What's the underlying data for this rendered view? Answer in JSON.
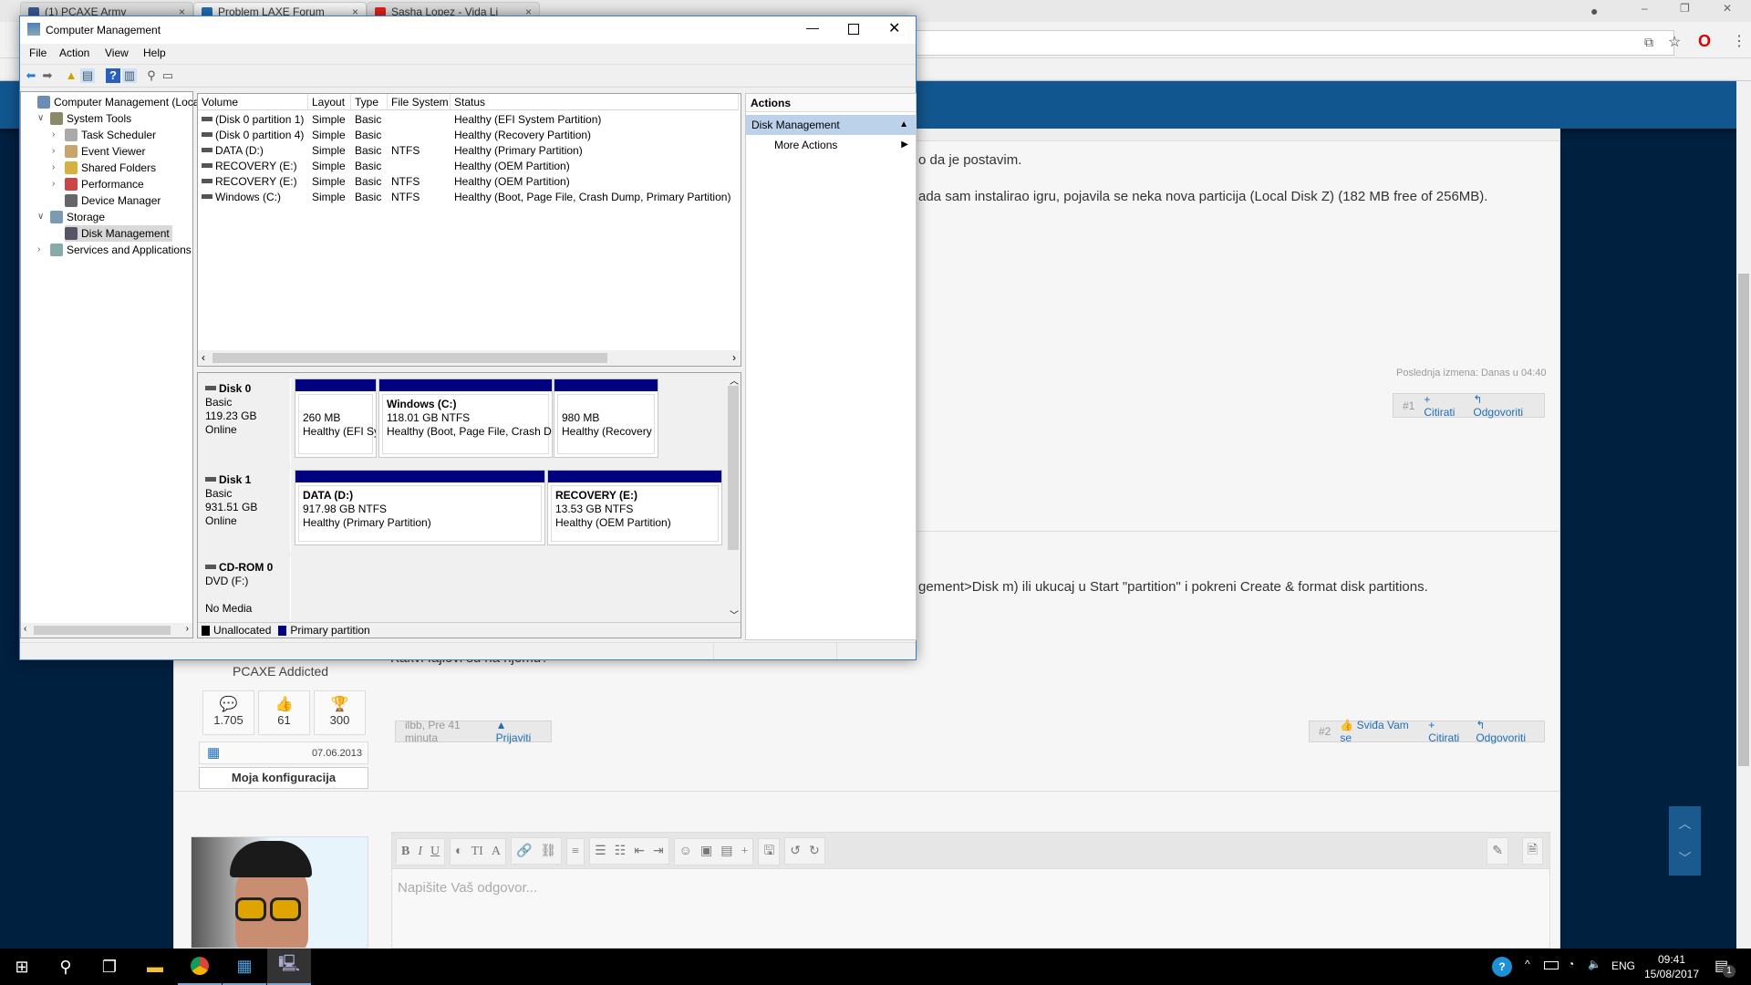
{
  "browser": {
    "tabs": [
      {
        "label": "(1) PCAXE Army",
        "color": "#3b5998"
      },
      {
        "label": "Problem LAXE Forum",
        "color": "#1f6fb5"
      },
      {
        "label": "Sasha Lopez - Vida Li",
        "color": "#e62117"
      }
    ],
    "close": "×"
  },
  "forum": {
    "post1": {
      "line1": "o da je postavim.",
      "line2": "ada sam instalirao igru, pojavila se neka nova particija (Local Disk Z) (182 MB free of 256MB).",
      "edited": "Poslednja izmena: Danas u 04:40",
      "num": "#1",
      "quote": "+ Citirati",
      "reply": "Odgovoriti"
    },
    "post2": {
      "line1": "gement>Disk m) ili ukucaj u Start \"partition\" i pokreni Create & format disk partitions.",
      "line2": "Kakvi fajlovi su na njemu?",
      "meta": "ilbb, Pre 41 minuta",
      "report": "Prijaviti",
      "num": "#2",
      "like": "Sviđa Vam se",
      "quote": "+ Citirati",
      "reply": "Odgovoriti"
    },
    "user": {
      "rank": "PCAXE Addicted",
      "posts": "1.705",
      "likes": "61",
      "trophies": "300",
      "joined": "07.06.2013",
      "config": "Moja konfiguracija"
    },
    "editor": {
      "placeholder": "Napišite Vaš odgovor..."
    }
  },
  "window": {
    "title": "Computer Management",
    "menu": [
      "File",
      "Action",
      "View",
      "Help"
    ],
    "tree": [
      {
        "label": "Computer Management (Local",
        "level": 0
      },
      {
        "label": "System Tools",
        "level": 1,
        "expanded": true
      },
      {
        "label": "Task Scheduler",
        "level": 2
      },
      {
        "label": "Event Viewer",
        "level": 2
      },
      {
        "label": "Shared Folders",
        "level": 2
      },
      {
        "label": "Performance",
        "level": 2
      },
      {
        "label": "Device Manager",
        "level": 2
      },
      {
        "label": "Storage",
        "level": 1,
        "expanded": true
      },
      {
        "label": "Disk Management",
        "level": 2,
        "selected": true
      },
      {
        "label": "Services and Applications",
        "level": 1
      }
    ],
    "columns": [
      "Volume",
      "Layout",
      "Type",
      "File System",
      "Status"
    ],
    "volumes": [
      [
        "(Disk 0 partition 1)",
        "Simple",
        "Basic",
        "",
        "Healthy (EFI System Partition)"
      ],
      [
        "(Disk 0 partition 4)",
        "Simple",
        "Basic",
        "",
        "Healthy (Recovery Partition)"
      ],
      [
        "DATA (D:)",
        "Simple",
        "Basic",
        "NTFS",
        "Healthy (Primary Partition)"
      ],
      [
        "RECOVERY (E:)",
        "Simple",
        "Basic",
        "",
        "Healthy (OEM Partition)"
      ],
      [
        "RECOVERY (E:)",
        "Simple",
        "Basic",
        "NTFS",
        "Healthy (OEM Partition)"
      ],
      [
        "Windows (C:)",
        "Simple",
        "Basic",
        "NTFS",
        "Healthy (Boot, Page File, Crash Dump, Primary Partition)"
      ]
    ],
    "disks": [
      {
        "name": "Disk 0",
        "type": "Basic",
        "size": "119.23 GB",
        "state": "Online",
        "parts": [
          {
            "name": "",
            "size": "260 MB",
            "status": "Healthy (EFI Sy"
          },
          {
            "name": "Windows  (C:)",
            "size": "118.01 GB NTFS",
            "status": "Healthy (Boot, Page File, Crash Du"
          },
          {
            "name": "",
            "size": "980 MB",
            "status": "Healthy (Recovery"
          }
        ]
      },
      {
        "name": "Disk 1",
        "type": "Basic",
        "size": "931.51 GB",
        "state": "Online",
        "parts": [
          {
            "name": "DATA  (D:)",
            "size": "917.98 GB NTFS",
            "status": "Healthy (Primary Partition)"
          },
          {
            "name": "RECOVERY  (E:)",
            "size": "13.53 GB NTFS",
            "status": "Healthy (OEM Partition)"
          }
        ]
      },
      {
        "name": "CD-ROM 0",
        "type": "DVD (F:)",
        "state": "No Media"
      }
    ],
    "legend": [
      {
        "label": "Unallocated",
        "color": "#000000"
      },
      {
        "label": "Primary partition",
        "color": "#000080"
      }
    ],
    "actions": {
      "header": "Actions",
      "section": "Disk Management",
      "more": "More Actions"
    }
  },
  "taskbar": {
    "lang": "ENG",
    "time": "09:41",
    "date": "15/08/2017",
    "notifications": "1"
  }
}
